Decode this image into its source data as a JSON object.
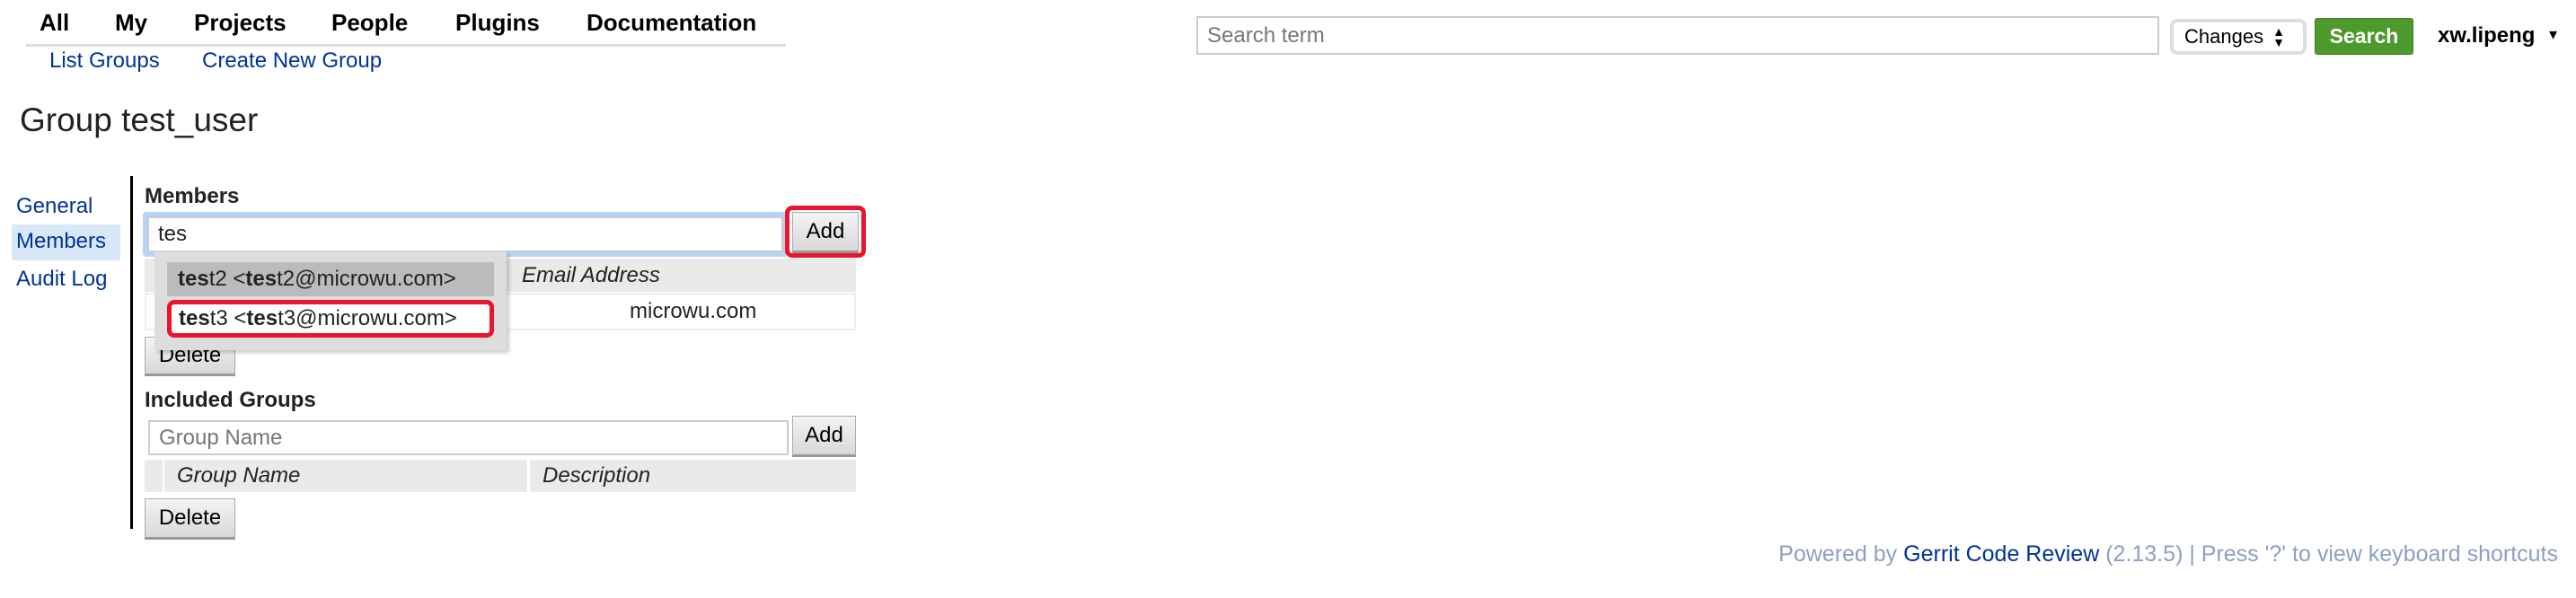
{
  "nav": {
    "items": [
      "All",
      "My",
      "Projects",
      "People",
      "Plugins",
      "Documentation"
    ]
  },
  "subnav": {
    "list_groups": "List Groups",
    "create_group": "Create New Group"
  },
  "title": "Group test_user",
  "sidebar": {
    "items": [
      "General",
      "Members",
      "Audit Log"
    ],
    "selected": "Members"
  },
  "members": {
    "heading": "Members",
    "input_value": "tes",
    "add_label": "Add",
    "table_header_email": "Email Address",
    "row_email": "microwu.com",
    "delete_label": "Delete",
    "suggestions": [
      {
        "match": "tes",
        "rest": "t2 <",
        "match2": "tes",
        "rest2": "t2@microwu.com>",
        "highlighted": true
      },
      {
        "match": "tes",
        "rest": "t3 <",
        "match2": "tes",
        "rest2": "t3@microwu.com>",
        "highlighted": false
      }
    ]
  },
  "included": {
    "heading": "Included Groups",
    "placeholder": "Group Name",
    "add_label": "Add",
    "col_group": "Group Name",
    "col_desc": "Description",
    "delete_label": "Delete"
  },
  "search": {
    "placeholder": "Search term",
    "scope": "Changes",
    "button": "Search"
  },
  "user": {
    "name": "xw.lipeng"
  },
  "footer": {
    "powered": "Powered by",
    "link": "Gerrit Code Review",
    "version": "(2.13.5) | Press '?' to view keyboard shortcuts"
  },
  "colors": {
    "link": "#003399",
    "search_button": "#4d9a2c",
    "highlight_annotation": "#e8152f"
  }
}
